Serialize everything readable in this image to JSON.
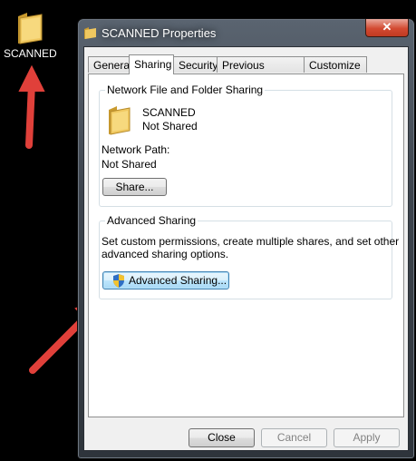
{
  "desktop": {
    "folder_label": "SCANNED",
    "folder_icon": "folder-icon"
  },
  "window": {
    "title": "SCANNED Properties",
    "close_glyph": "✕",
    "tabs": [
      {
        "label": "General"
      },
      {
        "label": "Sharing",
        "active": true
      },
      {
        "label": "Security"
      },
      {
        "label": "Previous Versions"
      },
      {
        "label": "Customize"
      }
    ],
    "network_sharing": {
      "group_title": "Network File and Folder Sharing",
      "folder_name": "SCANNED",
      "status": "Not Shared",
      "path_label": "Network Path:",
      "path_value": "Not Shared",
      "share_button": "Share..."
    },
    "advanced_sharing": {
      "group_title": "Advanced Sharing",
      "description_line1": "Set custom permissions, create multiple shares, and set other",
      "description_line2": "advanced sharing options.",
      "button": "Advanced Sharing..."
    },
    "buttons": {
      "close": "Close",
      "cancel": "Cancel",
      "apply": "Apply"
    }
  },
  "colors": {
    "annotation_arrow": "#e0403a",
    "title_close": "#c8442c",
    "focus_border": "#3c7fb1"
  }
}
